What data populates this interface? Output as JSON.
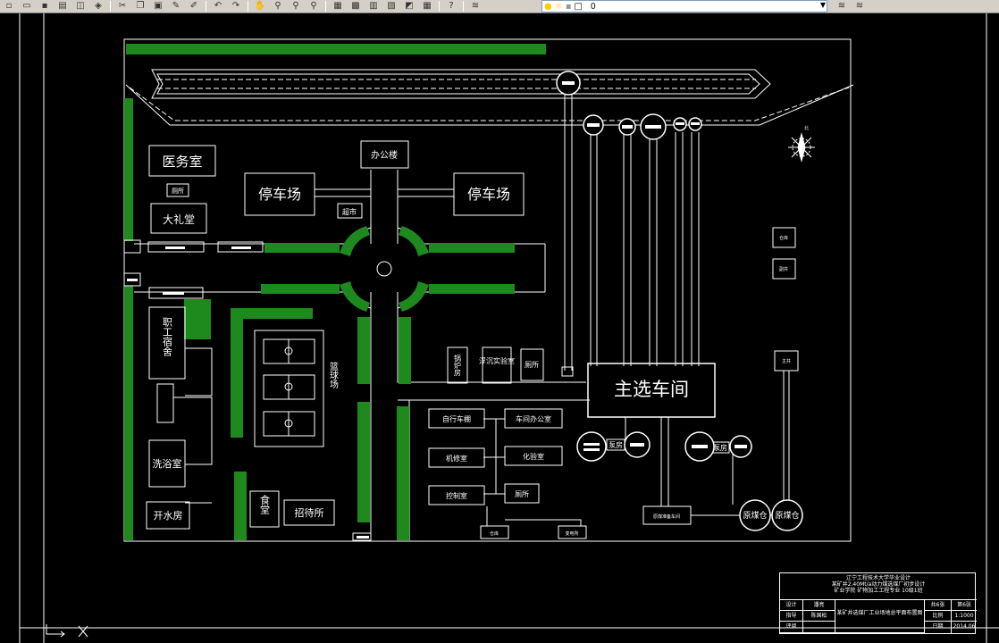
{
  "toolbar": {
    "buttons": [
      "new-icon",
      "open-icon",
      "save-icon",
      "plot-icon",
      "preview-icon",
      "publish-icon",
      "cut-icon",
      "copy-icon",
      "paste-icon",
      "matchprop-icon",
      "blockeditor-icon",
      "undo-icon",
      "redo-icon",
      "pan-icon",
      "zoom-realtime-icon",
      "zoom-window-icon",
      "zoom-previous-icon",
      "properties-icon",
      "designcenter-icon",
      "toolpalette-icon",
      "sheetset-icon",
      "markup-icon",
      "calculator-icon",
      "help-icon",
      "layer-manager-icon"
    ],
    "layer_value": "0",
    "colors": {
      "bg": "#d4d0c8",
      "sun": "#ffcc00"
    }
  },
  "drawing": {
    "colors": {
      "line": "#ffffff",
      "tree": "#22aa22",
      "bg": "#000000"
    },
    "labels": {
      "office": "办公楼",
      "parking_left": "停车场",
      "parking_right": "停车场",
      "clinic": "医务室",
      "toilet1": "厕所",
      "hall": "大礼堂",
      "market": "超市",
      "dorm": "职工宿舍",
      "basketball": "篮球场",
      "bath": "洗浴室",
      "water": "开水房",
      "canteen": "食堂",
      "guesthouse": "招待所",
      "boiler": "锅炉房",
      "flotation_lab": "浮沉实验室",
      "toilet2": "厕所",
      "main_plant": "主选车间",
      "bike_shed": "自行车棚",
      "workshop_office": "车间办公室",
      "repair": "机修室",
      "chem_lab": "化验室",
      "control": "控制室",
      "toilet3": "厕所",
      "warehouse": "仓库",
      "substation": "变电所",
      "pump1": "泵房",
      "pump2": "泵房",
      "raw_coal1": "原煤仓",
      "raw_coal2": "原煤仓",
      "raw_prep": "原煤准备车间",
      "small_a": "仓库",
      "small_b": "副井",
      "small_c": "主井",
      "north": "北"
    }
  },
  "title_block": {
    "school": "辽宁工程技术大学毕业设计",
    "project": "某矿井2.40Mt/a动力煤选煤厂初步设计",
    "dept": "矿业学院 矿物加工工程专业 10级1班",
    "design_label": "设计",
    "design_name": "潘亮",
    "guide_label": "指导",
    "guide_name": "陈国松",
    "review_label": "评阅",
    "review_name": "",
    "drawing_title": "某矿井选煤厂工业场地总平面布置图",
    "sheets": "共6张",
    "sheet_no": "第6张",
    "scale_label": "比例",
    "scale": "1:1000",
    "date_label": "日期",
    "date": "2014.06"
  }
}
